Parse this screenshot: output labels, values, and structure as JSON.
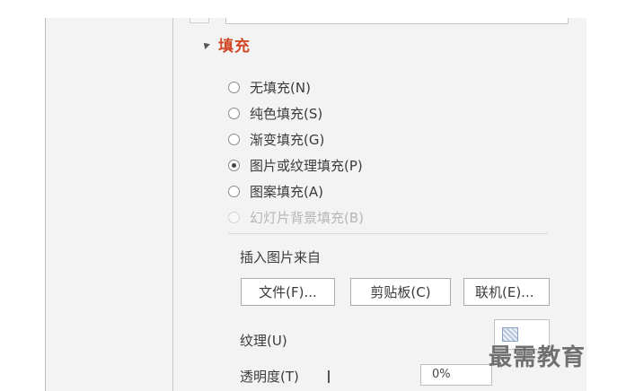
{
  "fill_section": {
    "title": "填充"
  },
  "fill_options": [
    {
      "label": "无填充(N)",
      "checked": false,
      "disabled": false
    },
    {
      "label": "纯色填充(S)",
      "checked": false,
      "disabled": false
    },
    {
      "label": "渐变填充(G)",
      "checked": false,
      "disabled": false
    },
    {
      "label": "图片或纹理填充(P)",
      "checked": true,
      "disabled": false
    },
    {
      "label": "图案填充(A)",
      "checked": false,
      "disabled": false
    },
    {
      "label": "幻灯片背景填充(B)",
      "checked": false,
      "disabled": true
    }
  ],
  "picture_source": {
    "label": "插入图片来自",
    "file_button": "文件(F)...",
    "clipboard_button": "剪贴板(C)",
    "online_button": "联机(E)..."
  },
  "texture": {
    "label": "纹理(U)"
  },
  "transparency": {
    "label": "透明度(T)",
    "value": "0%"
  },
  "watermark": "最需教育",
  "colors": {
    "accent": "#d24726",
    "panel_bg": "#f3f3f3"
  }
}
